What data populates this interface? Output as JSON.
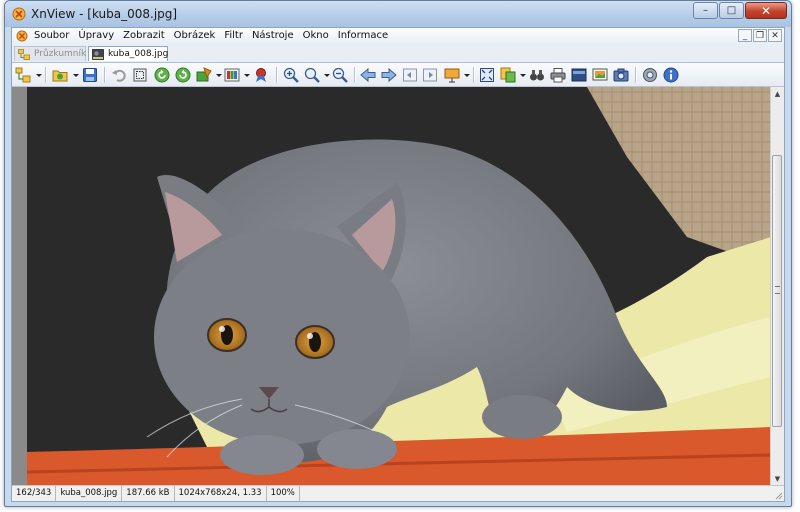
{
  "window": {
    "title": "XnView - [kuba_008.jpg]",
    "controls": {
      "minimize": "–",
      "maximize": "□",
      "close": "✕"
    }
  },
  "menu": {
    "items": [
      "Soubor",
      "Úpravy",
      "Zobrazit",
      "Obrázek",
      "Filtr",
      "Nástroje",
      "Okno",
      "Informace"
    ],
    "mdi_controls": [
      "_",
      "❐",
      "✕"
    ]
  },
  "tabs": [
    {
      "label": "Průzkumník",
      "active": false,
      "icon": "explorer-icon"
    },
    {
      "label": "kuba_008.jpg",
      "active": true,
      "icon": "image-thumbnail-icon"
    }
  ],
  "toolbar": {
    "buttons": [
      "browser-tree-icon",
      "open-folder-icon",
      "save-icon",
      "undo-icon",
      "crop-icon",
      "rotate-left-icon",
      "rotate-right-icon",
      "image-adjust-icon",
      "color-icon",
      "filter-icon",
      "zoom-in-icon",
      "zoom-icon",
      "zoom-out-icon",
      "previous-icon",
      "next-icon",
      "first-icon",
      "last-icon",
      "slideshow-icon",
      "fit-screen-icon",
      "copy-icon",
      "find-icon",
      "print-icon",
      "fullscreen-icon",
      "capture-icon",
      "camera-icon",
      "settings-icon",
      "info-icon"
    ],
    "colors": {
      "green": "#3f9a2e",
      "blue": "#3a73c9",
      "orange": "#e08a1e",
      "red": "#c8342b"
    }
  },
  "image": {
    "subject": "gray-kitten-photo",
    "colors": {
      "cat": "#7b7d85",
      "eyes": "#c9892a",
      "blanket": "#ece8a8",
      "couch": "#2a2a2a",
      "rug": "#d9582c",
      "wall": "#b9a58c"
    }
  },
  "status": {
    "index": "162/343",
    "filename": "kuba_008.jpg",
    "size": "187.66 kB",
    "dimensions": "1024x768x24, 1.33",
    "zoom": "100%"
  }
}
